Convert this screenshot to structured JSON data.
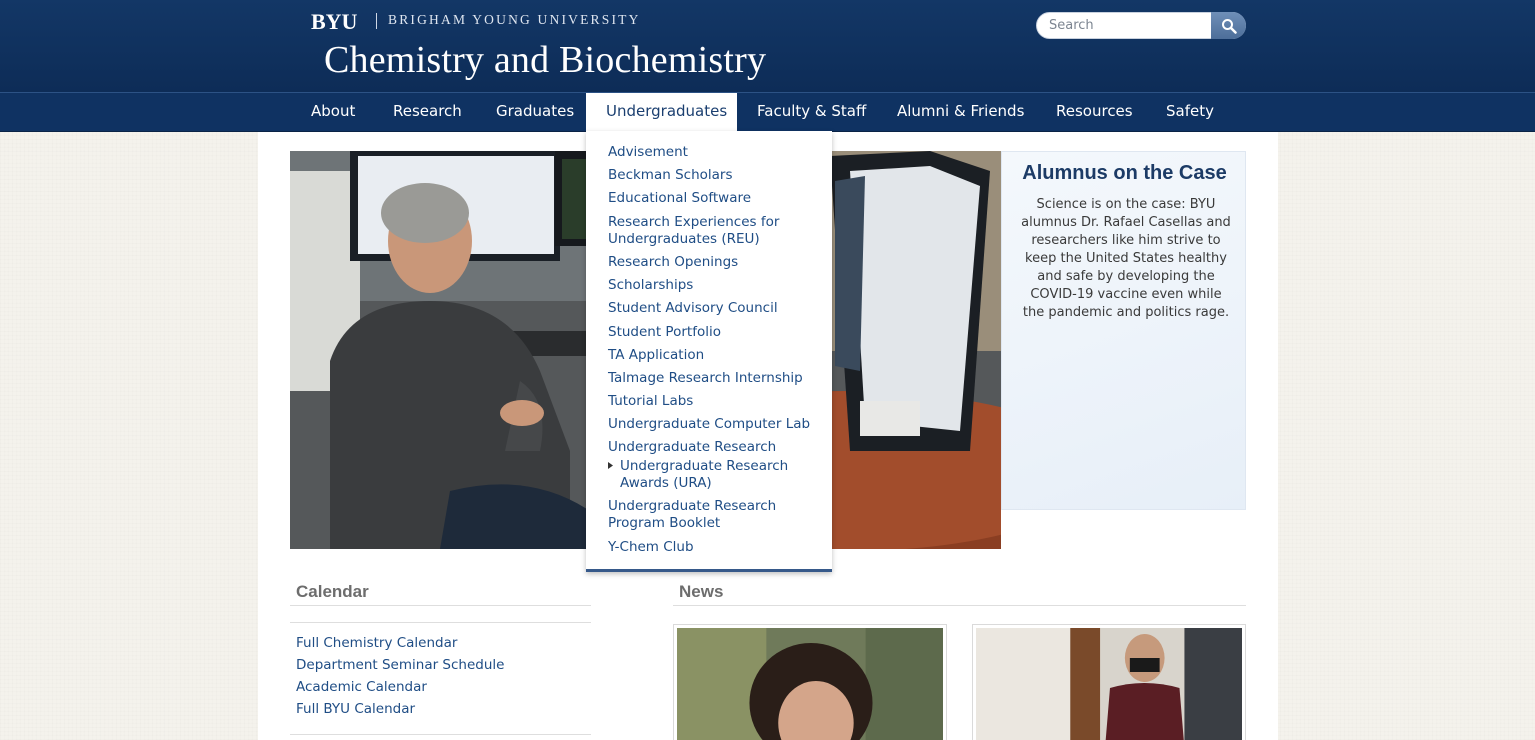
{
  "header": {
    "logo": "BYU",
    "university": "BRIGHAM YOUNG UNIVERSITY",
    "site_title": "Chemistry and Biochemistry",
    "search_placeholder": "Search"
  },
  "nav": {
    "items": [
      {
        "label": "About"
      },
      {
        "label": "Research"
      },
      {
        "label": "Graduates"
      },
      {
        "label": "Undergraduates"
      },
      {
        "label": "Faculty & Staff"
      },
      {
        "label": "Alumni & Friends"
      },
      {
        "label": "Resources"
      },
      {
        "label": "Safety"
      }
    ],
    "active": "Undergraduates"
  },
  "dropdown": {
    "items": [
      {
        "label": "Advisement"
      },
      {
        "label": "Beckman Scholars"
      },
      {
        "label": "Educational Software"
      },
      {
        "label": "Research Experiences for Undergraduates (REU)"
      },
      {
        "label": "Research Openings"
      },
      {
        "label": "Scholarships"
      },
      {
        "label": "Student Advisory Council"
      },
      {
        "label": "Student Portfolio"
      },
      {
        "label": "TA Application"
      },
      {
        "label": "Talmage Research Internship"
      },
      {
        "label": "Tutorial Labs"
      },
      {
        "label": "Undergraduate Computer Lab"
      },
      {
        "label": "Undergraduate Research"
      },
      {
        "label": "Undergraduate Research Awards (URA)"
      },
      {
        "label": "Undergraduate Research Program Booklet"
      },
      {
        "label": "Y-Chem Club"
      }
    ]
  },
  "feature": {
    "title": "Alumnus on the Case",
    "body": "Science is on the case: BYU alumnus Dr. Rafael Casellas and researchers like him strive to keep the United States healthy and safe by developing the COVID-19 vaccine even while the pandemic and politics rage."
  },
  "calendar": {
    "title": "Calendar",
    "links": [
      {
        "label": "Full Chemistry Calendar"
      },
      {
        "label": "Department Seminar Schedule"
      },
      {
        "label": "Academic Calendar"
      },
      {
        "label": "Full BYU Calendar"
      }
    ]
  },
  "news": {
    "title": "News"
  },
  "colors": {
    "header_bg": "#133766",
    "nav_bg": "#0f3262",
    "link": "#1f4d85",
    "feature_title": "#1c3b66"
  },
  "icons": {
    "search": "search-icon",
    "submenu": "triangle-bullet-icon"
  }
}
